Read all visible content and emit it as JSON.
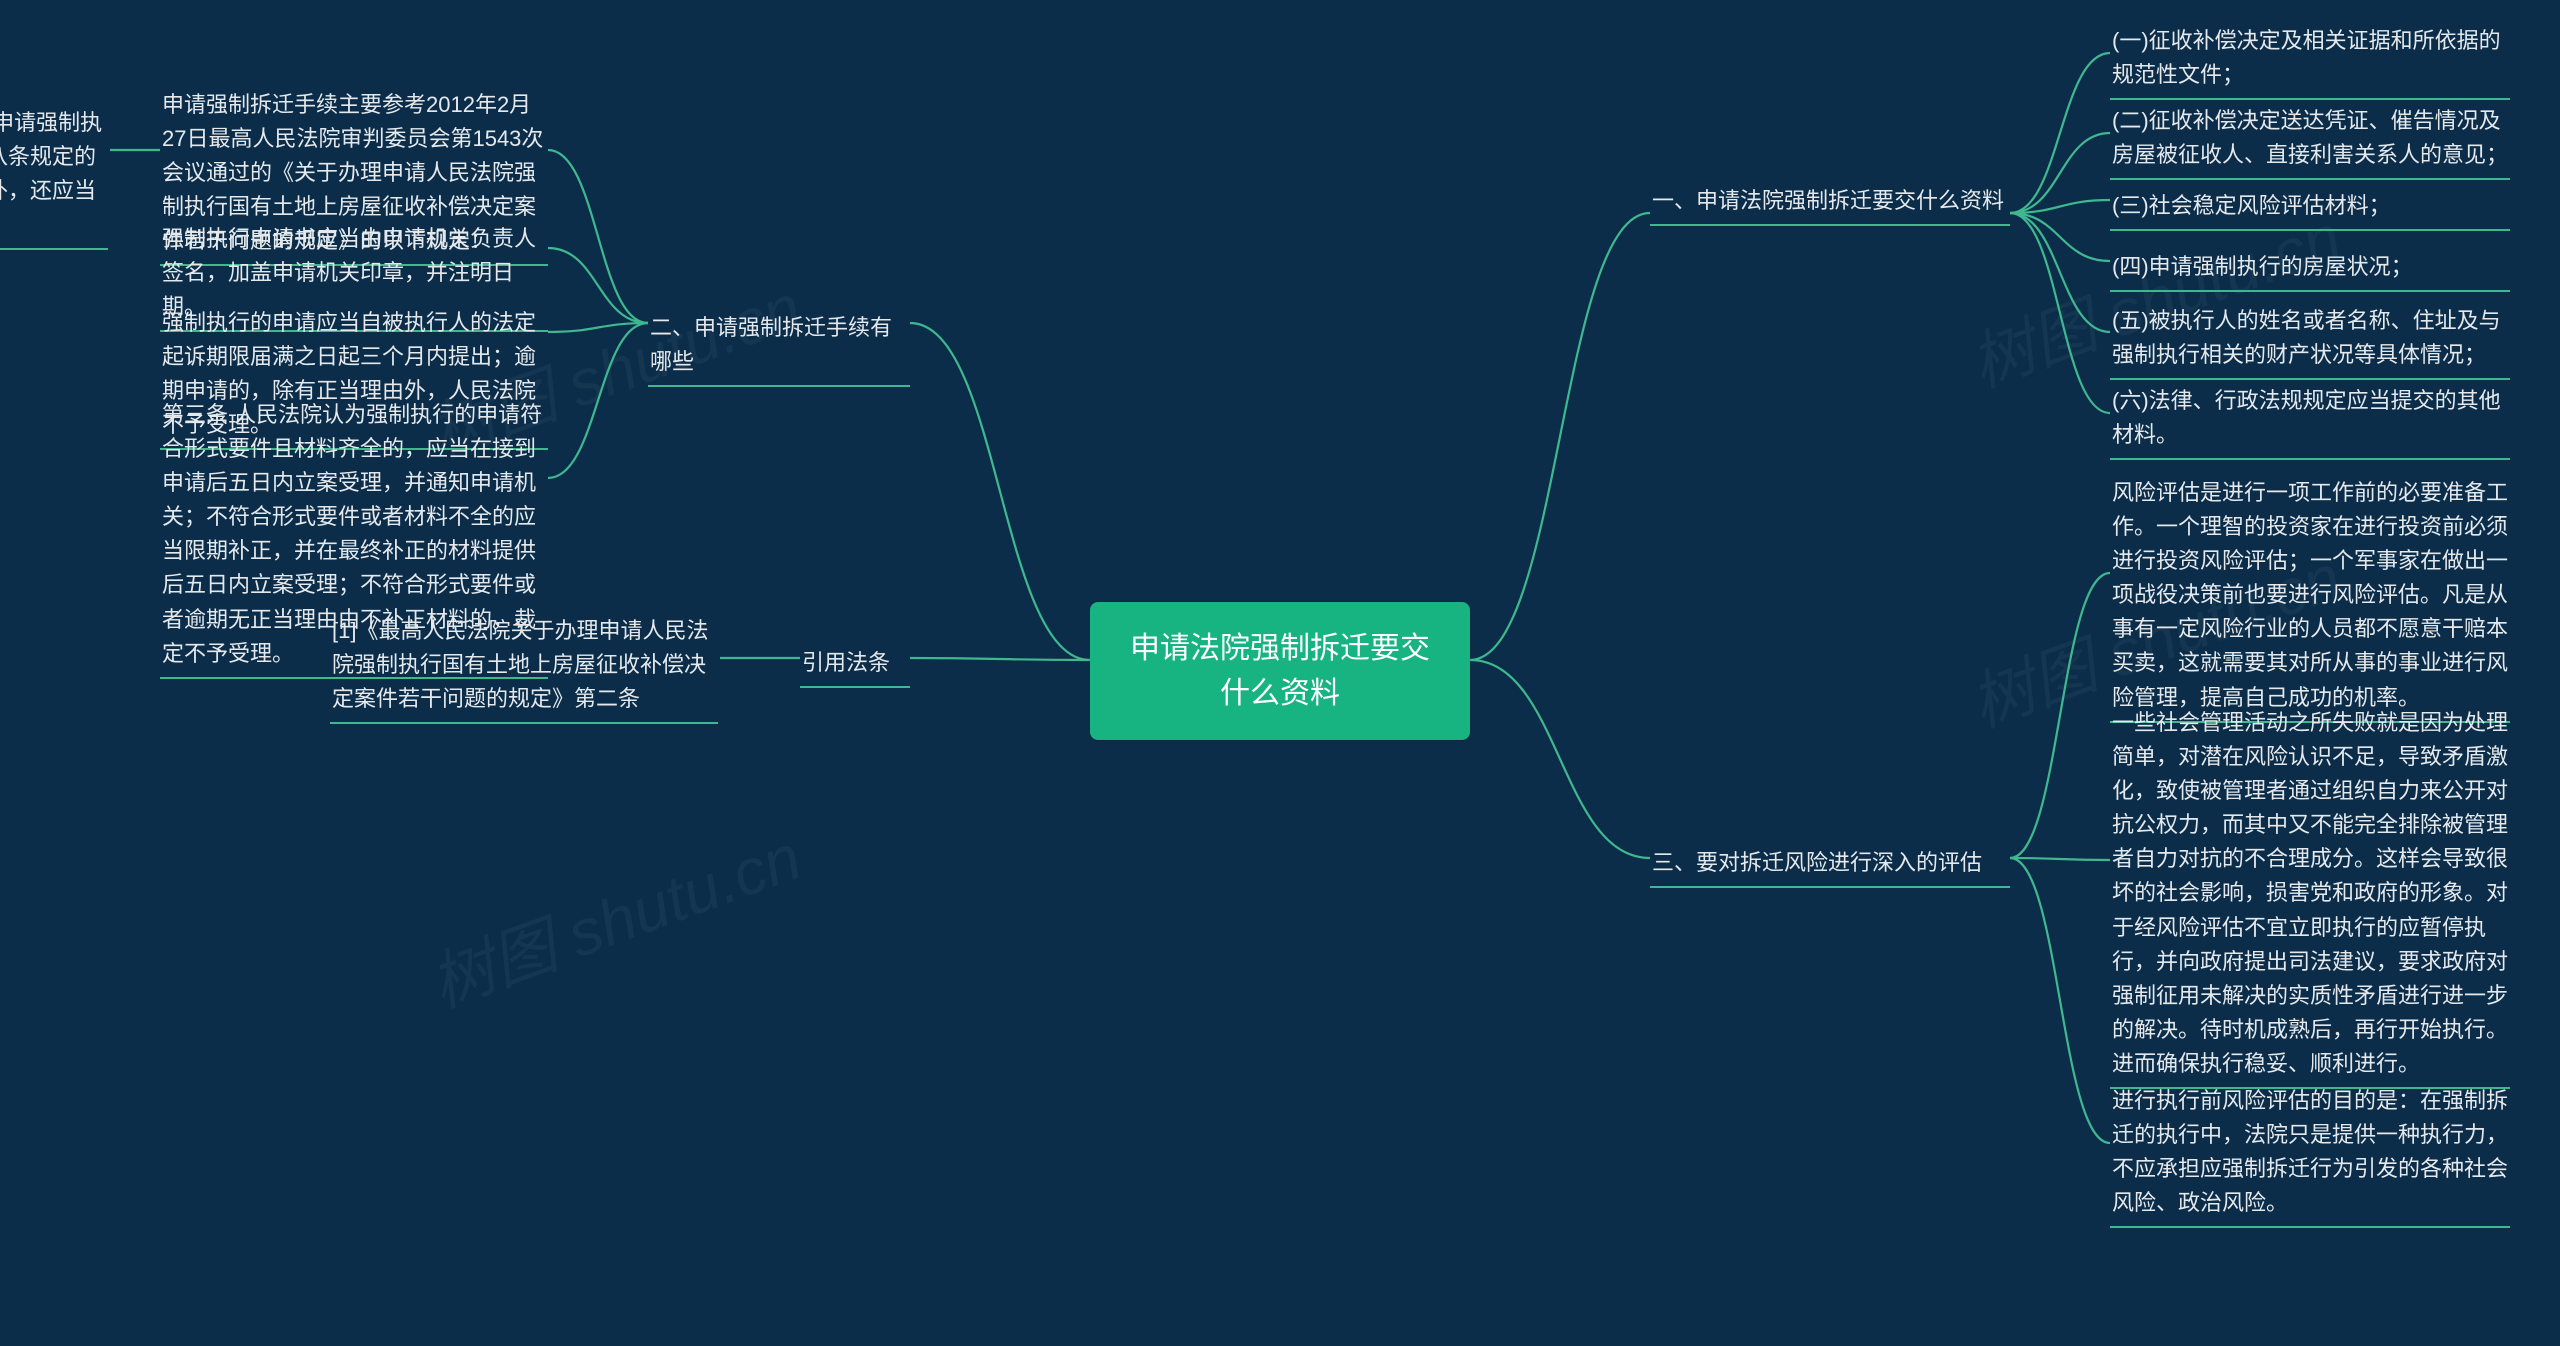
{
  "center": {
    "title": "申请法院强制拆迁要交什么资料"
  },
  "branches": {
    "one": {
      "title": "一、申请法院强制拆迁要交什么资料",
      "items": {
        "a": "(一)征收补偿决定及相关证据和所依据的规范性文件；",
        "b": "(二)征收补偿决定送达凭证、催告情况及房屋被征收人、直接利害关系人的意见；",
        "c": "(三)社会稳定风险评估材料；",
        "d": "(四)申请强制执行的房屋状况；",
        "e": "(五)被执行人的姓名或者名称、住址及与强制执行相关的财产状况等具体情况；",
        "f": "(六)法律、行政法规规定应当提交的其他材料。"
      }
    },
    "two": {
      "title": "二、申请强制拆迁手续有哪些",
      "items": {
        "a": "申请强制拆迁手续主要参考2012年2月27日最高人民法院审判委员会第1543次会议通过的《关于办理申请人民法院强制执行国有土地上房屋征收补偿决定案件若干问题的规定》的以下规定：",
        "a_sub": "第二条 申请机关向人民法院申请强制执行，除提供《条例》第二十八条规定的强制执行申请书及附具材料外，还应当提供法律规定的材料。",
        "b": "强制执行申请书应当由申请机关负责人签名，加盖申请机关印章，并注明日期。",
        "c": "强制执行的申请应当自被执行人的法定起诉期限届满之日起三个月内提出；逾期申请的，除有正当理由外，人民法院不予受理。",
        "d": "第三条 人民法院认为强制执行的申请符合形式要件且材料齐全的，应当在接到申请后五日内立案受理，并通知申请机关；不符合形式要件或者材料不全的应当限期补正，并在最终补正的材料提供后五日内立案受理；不符合形式要件或者逾期无正当理由由不补正材料的，裁定不予受理。"
      }
    },
    "three": {
      "title": "三、要对拆迁风险进行深入的评估",
      "items": {
        "a": "风险评估是进行一项工作前的必要准备工作。一个理智的投资家在进行投资前必须进行投资风险评估；一个军事家在做出一项战役决策前也要进行风险评估。凡是从事有一定风险行业的人员都不愿意干赔本买卖，这就需要其对所从事的事业进行风险管理，提高自己成功的机率。",
        "b": "一些社会管理活动之所失败就是因为处理简单，对潜在风险认识不足，导致矛盾激化，致使被管理者通过组织自力来公开对抗公权力，而其中又不能完全排除被管理者自力对抗的不合理成分。这样会导致很坏的社会影响，损害党和政府的形象。对于经风险评估不宜立即执行的应暂停执行，并向政府提出司法建议，要求政府对强制征用未解决的实质性矛盾进行进一步的解决。待时机成熟后，再行开始执行。进而确保执行稳妥、顺利进行。",
        "c": "进行执行前风险评估的目的是：在强制拆迁的执行中，法院只是提供一种执行力，不应承担应强制拆迁行为引发的各种社会风险、政治风险。"
      }
    },
    "cite": {
      "title": "引用法条",
      "items": {
        "a": "[1]《最高人民法院关于办理申请人民法院强制执行国有土地上房屋征收补偿决定案件若干问题的规定》第二条"
      }
    }
  },
  "watermark": "树图 shutu.cn"
}
